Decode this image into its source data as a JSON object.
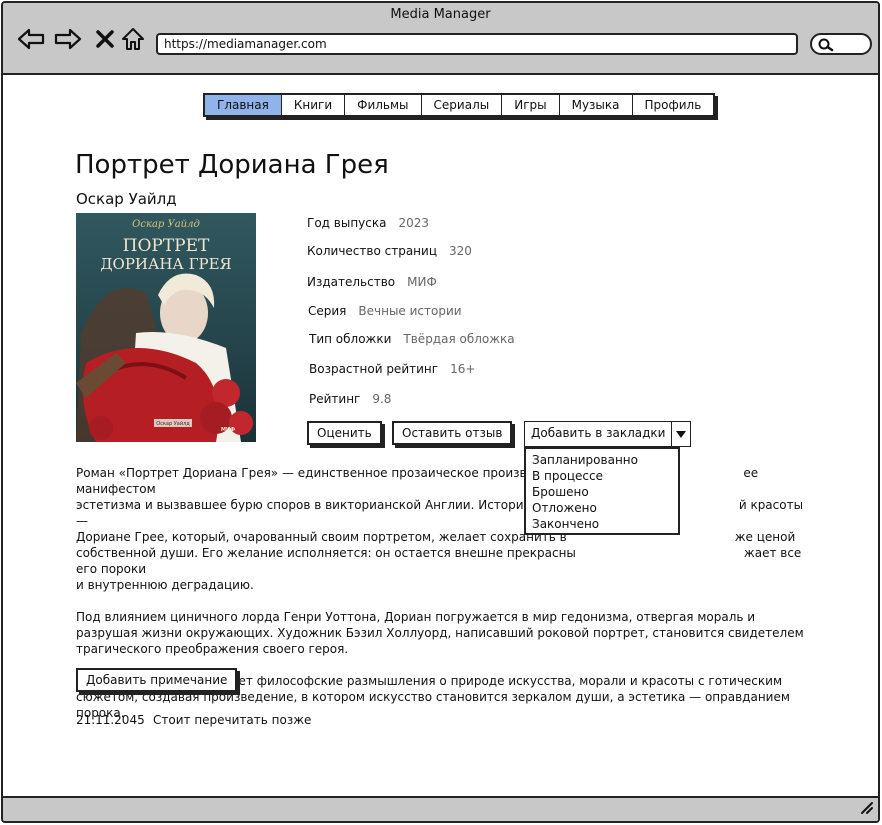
{
  "window": {
    "title": "Media Manager",
    "url": "https://mediamanager.com"
  },
  "nav": {
    "tabs": [
      {
        "label": "Главная",
        "active": true
      },
      {
        "label": "Книги",
        "active": false
      },
      {
        "label": "Фильмы",
        "active": false
      },
      {
        "label": "Сериалы",
        "active": false
      },
      {
        "label": "Игры",
        "active": false
      },
      {
        "label": "Музыка",
        "active": false
      },
      {
        "label": "Профиль",
        "active": false
      }
    ]
  },
  "book": {
    "title": "Портрет Дориана Грея",
    "author": "Оскар Уайлд",
    "cover": {
      "author_script": "Оскар Уайлд",
      "title_line1": "ПОРТРЕТ",
      "title_line2": "ДОРИАНА ГРЕЯ",
      "series_small": "Оскар Уайлд",
      "publisher_small": "МИФ"
    },
    "details": [
      {
        "label": "Год выпуска",
        "value": "2023"
      },
      {
        "label": "Количество страниц",
        "value": "320"
      },
      {
        "label": "Издательство",
        "value": "МИФ"
      },
      {
        "label": "Серия",
        "value": "Вечные истории"
      },
      {
        "label": "Тип обложки",
        "value": "Твёрдая обложка"
      },
      {
        "label": "Возрастной рейтинг",
        "value": "16+"
      },
      {
        "label": "Рейтинг",
        "value": "9.8"
      }
    ]
  },
  "actions": {
    "rate_label": "Оценить",
    "review_label": "Оставить отзыв",
    "bookmark_label": "Добавить в закладки",
    "bookmark_options": [
      "Запланированно",
      "В процессе",
      "Брошено",
      "Отложено",
      "Закончено"
    ]
  },
  "description": {
    "paragraph1_part1": "Роман «Портрет Дориана Грея» — единственное прозаическое произведени",
    "paragraph1_part1b": "ее манифестом",
    "paragraph1_part2": "эстетизма и вызвавшее бурю споров в викторианской Англии. История повес",
    "paragraph1_part2b": "й красоты —",
    "paragraph1_part3": "Дориане Грее, который, очарованный своим портретом, желает сохранить в",
    "paragraph1_part3b": "же ценой",
    "paragraph1_part4": "собственной души. Его желание исполняется: он остается внешне прекрасны",
    "paragraph1_part4b": "жает все его пороки",
    "paragraph1_part5": "и внутреннюю деградацию.",
    "paragraph2": "Под влиянием циничного лорда Генри Уоттона, Дориан погружается в мир гедонизма, отвергая мораль и разрушая жизни окружающих. Художник Бэзил Холлуорд, написавший роковой портрет, становится свидетелем трагического преображения своего героя.",
    "paragraph3": "Уайльд мастерски сочетает философские размышления о природе искусства, морали и красоты с готическим сюжетом, создавая произведение, в котором искусство становится зеркалом души, а эстетика — оправданием порока."
  },
  "notes": {
    "add_note_label": "Добавить примечание",
    "date": "21.11.2045",
    "text": "Стоит перечитать позже"
  }
}
